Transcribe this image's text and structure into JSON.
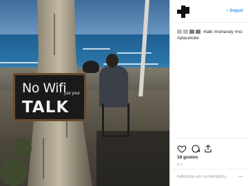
{
  "header": {
    "follow_label": "• Seguir"
  },
  "caption": {
    "text": "#talk #nohandy #no #placetobe"
  },
  "photo": {
    "sign_line1": "No Wifi",
    "sign_line2": "TALK",
    "sign_small": "just your"
  },
  "actions": {
    "likes": "18 gostos",
    "date": "9 D",
    "comment_placeholder": "Adiciona um comentário...",
    "more_label": "···"
  },
  "icons": [
    "heart-icon",
    "comment-icon",
    "share-icon"
  ]
}
